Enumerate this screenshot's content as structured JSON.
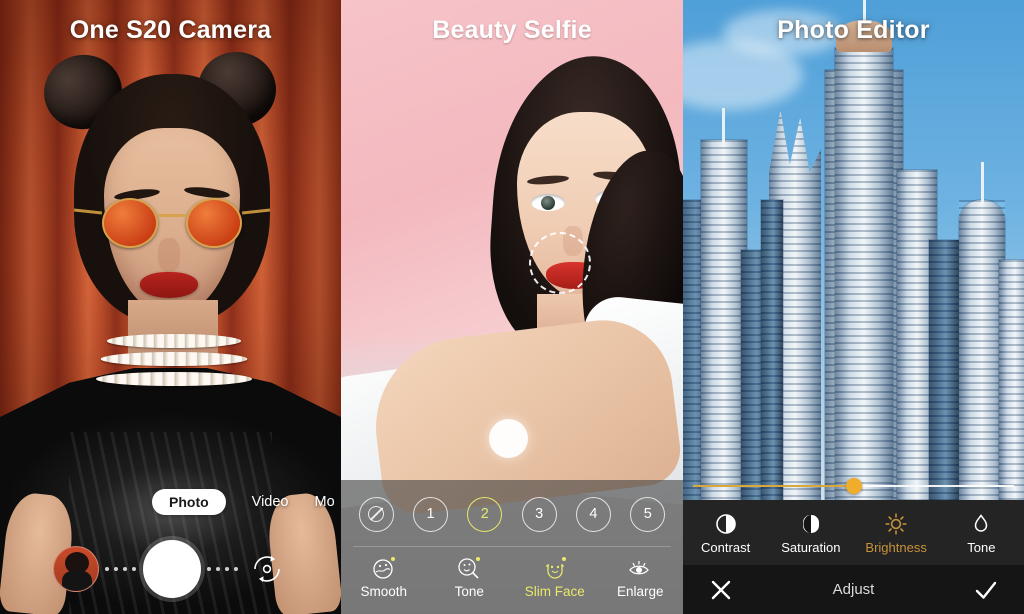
{
  "panels": [
    {
      "id": "camera",
      "title": "One S20 Camera",
      "modes": [
        {
          "label": "Photo",
          "selected": true
        },
        {
          "label": "Video",
          "selected": false
        },
        {
          "label": "Mo",
          "selected": false
        }
      ],
      "controls": {
        "gallery_thumbnail": "gallery-thumbnail",
        "shutter": "shutter-button",
        "flip_camera": "flip-camera-icon"
      }
    },
    {
      "id": "beauty",
      "title": "Beauty Selfie",
      "levels": [
        {
          "label": "",
          "icon": "no-effect-icon",
          "selected": false
        },
        {
          "label": "1",
          "icon": "",
          "selected": false
        },
        {
          "label": "2",
          "icon": "",
          "selected": true
        },
        {
          "label": "3",
          "icon": "",
          "selected": false
        },
        {
          "label": "4",
          "icon": "",
          "selected": false
        },
        {
          "label": "5",
          "icon": "",
          "selected": false
        }
      ],
      "tools": [
        {
          "label": "Smooth",
          "icon": "smooth-icon",
          "active": false,
          "dot": true
        },
        {
          "label": "Tone",
          "icon": "tone-icon",
          "active": false,
          "dot": true
        },
        {
          "label": "Slim Face",
          "icon": "slim-face-icon",
          "active": true,
          "dot": true
        },
        {
          "label": "Enlarge",
          "icon": "enlarge-eye-icon",
          "active": false,
          "dot": false
        }
      ],
      "overlays": {
        "retouch_circle": "retouch-selection-circle",
        "touch_indicator": "touch-indicator"
      },
      "accent": "#e8e86a"
    },
    {
      "id": "editor",
      "title": "Photo Editor",
      "slider": {
        "value": 50,
        "min": 0,
        "max": 100,
        "fill_color": "#d8a83c",
        "knob_color": "#f0ac2b"
      },
      "tools": [
        {
          "label": "Contrast",
          "icon": "contrast-icon",
          "active": false
        },
        {
          "label": "Saturation",
          "icon": "saturation-icon",
          "active": false
        },
        {
          "label": "Brightness",
          "icon": "brightness-icon",
          "active": true
        },
        {
          "label": "Tone",
          "icon": "tone-drop-icon",
          "active": false
        }
      ],
      "actions": {
        "cancel": "close-icon",
        "title": "Adjust",
        "confirm": "check-icon"
      },
      "accent": "#c8923a"
    }
  ]
}
